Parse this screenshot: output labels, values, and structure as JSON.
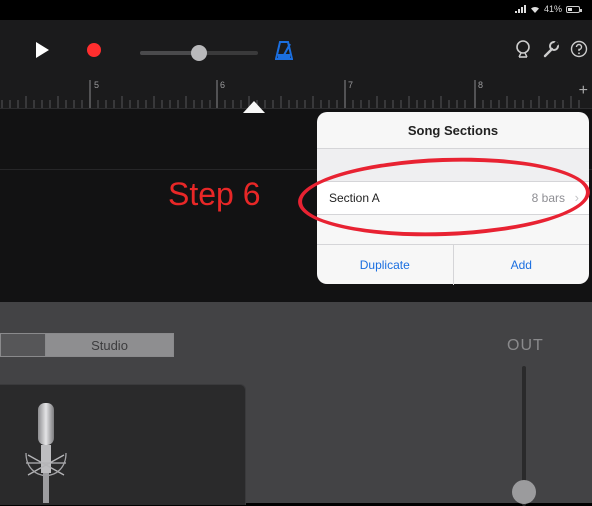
{
  "status_bar": {
    "battery_text": "41%",
    "battery_level": 0.41
  },
  "toolbar": {
    "icons": {
      "play": "play-icon",
      "record": "record-icon",
      "metronome": "metronome-icon",
      "loop": "loop-icon",
      "settings": "wrench-icon",
      "help": "help-icon"
    },
    "master_volume": 0.5,
    "accent_color": "#1b6fe0",
    "record_color": "#ff2e2e"
  },
  "ruler": {
    "bar_numbers": [
      "5",
      "6",
      "7",
      "8"
    ],
    "add_section_label": "+"
  },
  "annotation": {
    "step_text": "Step 6",
    "color": "#e82232"
  },
  "song_sections_popover": {
    "title": "Song Sections",
    "sections": [
      {
        "name": "Section A",
        "length": "8 bars"
      }
    ],
    "duplicate_label": "Duplicate",
    "add_label": "Add"
  },
  "recorder": {
    "mode_selected": "Studio",
    "output_label": "OUT",
    "output_level": 0.1
  }
}
